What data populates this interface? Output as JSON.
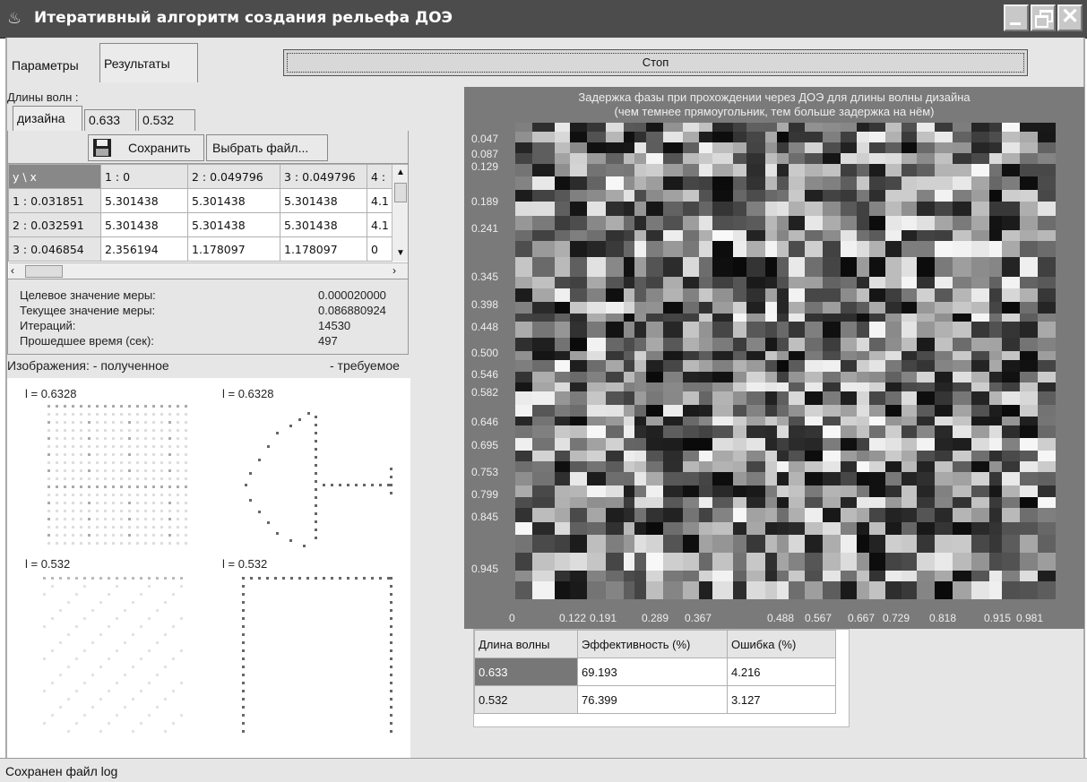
{
  "window": {
    "title": "Итеративный алгоритм создания рельефа ДОЭ"
  },
  "tabs": [
    "Параметры",
    "Результаты"
  ],
  "stop_label": "Стоп",
  "wavelengths_label": "Длины волн :",
  "wl_tabs": [
    "дизайна",
    "0.633",
    "0.532"
  ],
  "toolbar": {
    "save": "Сохранить",
    "choose": "Выбрать файл..."
  },
  "grid": {
    "header": [
      "y \\ x",
      "1 : 0",
      "2 : 0.049796",
      "3 : 0.049796",
      "4 :"
    ],
    "rows": [
      [
        "1 : 0.031851",
        "5.301438",
        "5.301438",
        "5.301438",
        "4.1"
      ],
      [
        "2 : 0.032591",
        "5.301438",
        "5.301438",
        "5.301438",
        "4.1"
      ],
      [
        "3 : 0.046854",
        "2.356194",
        "1.178097",
        "1.178097",
        "0"
      ]
    ]
  },
  "stats": [
    {
      "label": "Целевое значение меры:",
      "value": "0.000020000"
    },
    {
      "label": "Текущее значение меры:",
      "value": "0.086880924"
    },
    {
      "label": "Итераций:",
      "value": "14530"
    },
    {
      "label": "Прошедшее время (сек):",
      "value": "497"
    }
  ],
  "images_label": "Изображения:  - полученное",
  "required_label": "- требуемое",
  "image_labels": [
    "l = 0.6328",
    "l = 0.6328",
    "l = 0.532",
    "l = 0.532"
  ],
  "heatmap": {
    "title1": "Задержка фазы при прохождении через ДОЭ для длины волны дизайна",
    "title2": "(чем темнее прямоугольник, тем больше задержка на нём)",
    "y_ticks": [
      "0.047",
      "0.087",
      "0.129",
      "0.189",
      "0.241",
      "0.345",
      "0.398",
      "0.448",
      "0.500",
      "0.546",
      "0.582",
      "0.646",
      "0.695",
      "0.753",
      "0.799",
      "0.845",
      "0.945"
    ],
    "x_ticks": [
      "0",
      "0.122",
      "0.191",
      "0.289",
      "0.367",
      "0.488",
      "0.567",
      "0.667",
      "0.729",
      "0.818",
      "0.915",
      "0.981"
    ]
  },
  "results": {
    "header": [
      "Длина волны",
      "Эффективность (%)",
      "Ошибка (%)"
    ],
    "rows": [
      [
        "0.633",
        "69.193",
        "4.216"
      ],
      [
        "0.532",
        "76.399",
        "3.127"
      ]
    ]
  },
  "status": "Сохранен файл log"
}
